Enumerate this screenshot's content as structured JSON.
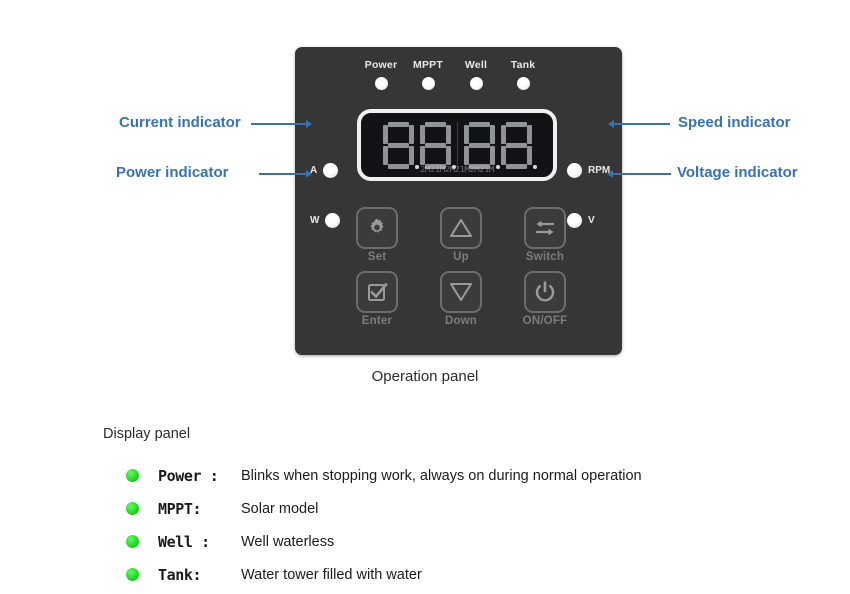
{
  "device": {
    "status_indicators": [
      {
        "label": "Power",
        "icon": "led-indicator"
      },
      {
        "label": "MPPT",
        "icon": "led-indicator"
      },
      {
        "label": "Well",
        "icon": "led-indicator"
      },
      {
        "label": "Tank",
        "icon": "led-indicator"
      }
    ],
    "side_indicators": {
      "current": {
        "label": "A",
        "icon": "led-indicator"
      },
      "power": {
        "label": "W",
        "icon": "led-indicator"
      },
      "speed": {
        "label": "RPM",
        "icon": "led-indicator"
      },
      "voltage": {
        "label": "V",
        "icon": "led-indicator"
      }
    },
    "display": {
      "value": "8888",
      "digit_count": 4,
      "watermark": "2M21M2M21M2M21M"
    },
    "keypad": [
      {
        "label": "Set",
        "icon": "gear-icon"
      },
      {
        "label": "Up",
        "icon": "triangle-up-icon"
      },
      {
        "label": "Switch",
        "icon": "swap-arrows-icon"
      },
      {
        "label": "Enter",
        "icon": "checkbox-check-icon"
      },
      {
        "label": "Down",
        "icon": "triangle-down-icon"
      },
      {
        "label": "ON/OFF",
        "icon": "power-icon"
      }
    ]
  },
  "callouts": {
    "current": "Current indicator",
    "power": "Power indicator",
    "speed": "Speed indicator",
    "voltage": "Voltage indicator"
  },
  "captions": {
    "operation_panel": "Operation panel",
    "display_panel": "Display panel"
  },
  "legend": [
    {
      "name": "Power :",
      "desc": "Blinks when stopping work, always on during normal operation"
    },
    {
      "name": "MPPT:",
      "desc": "Solar model"
    },
    {
      "name": "Well :",
      "desc": "Well waterless"
    },
    {
      "name": "Tank:",
      "desc": "Water tower filled with water"
    }
  ],
  "colors": {
    "accent_blue": "#3a72b0",
    "panel_body": "#363636",
    "led_green": "#19cc19",
    "segment": "#8f9398"
  }
}
